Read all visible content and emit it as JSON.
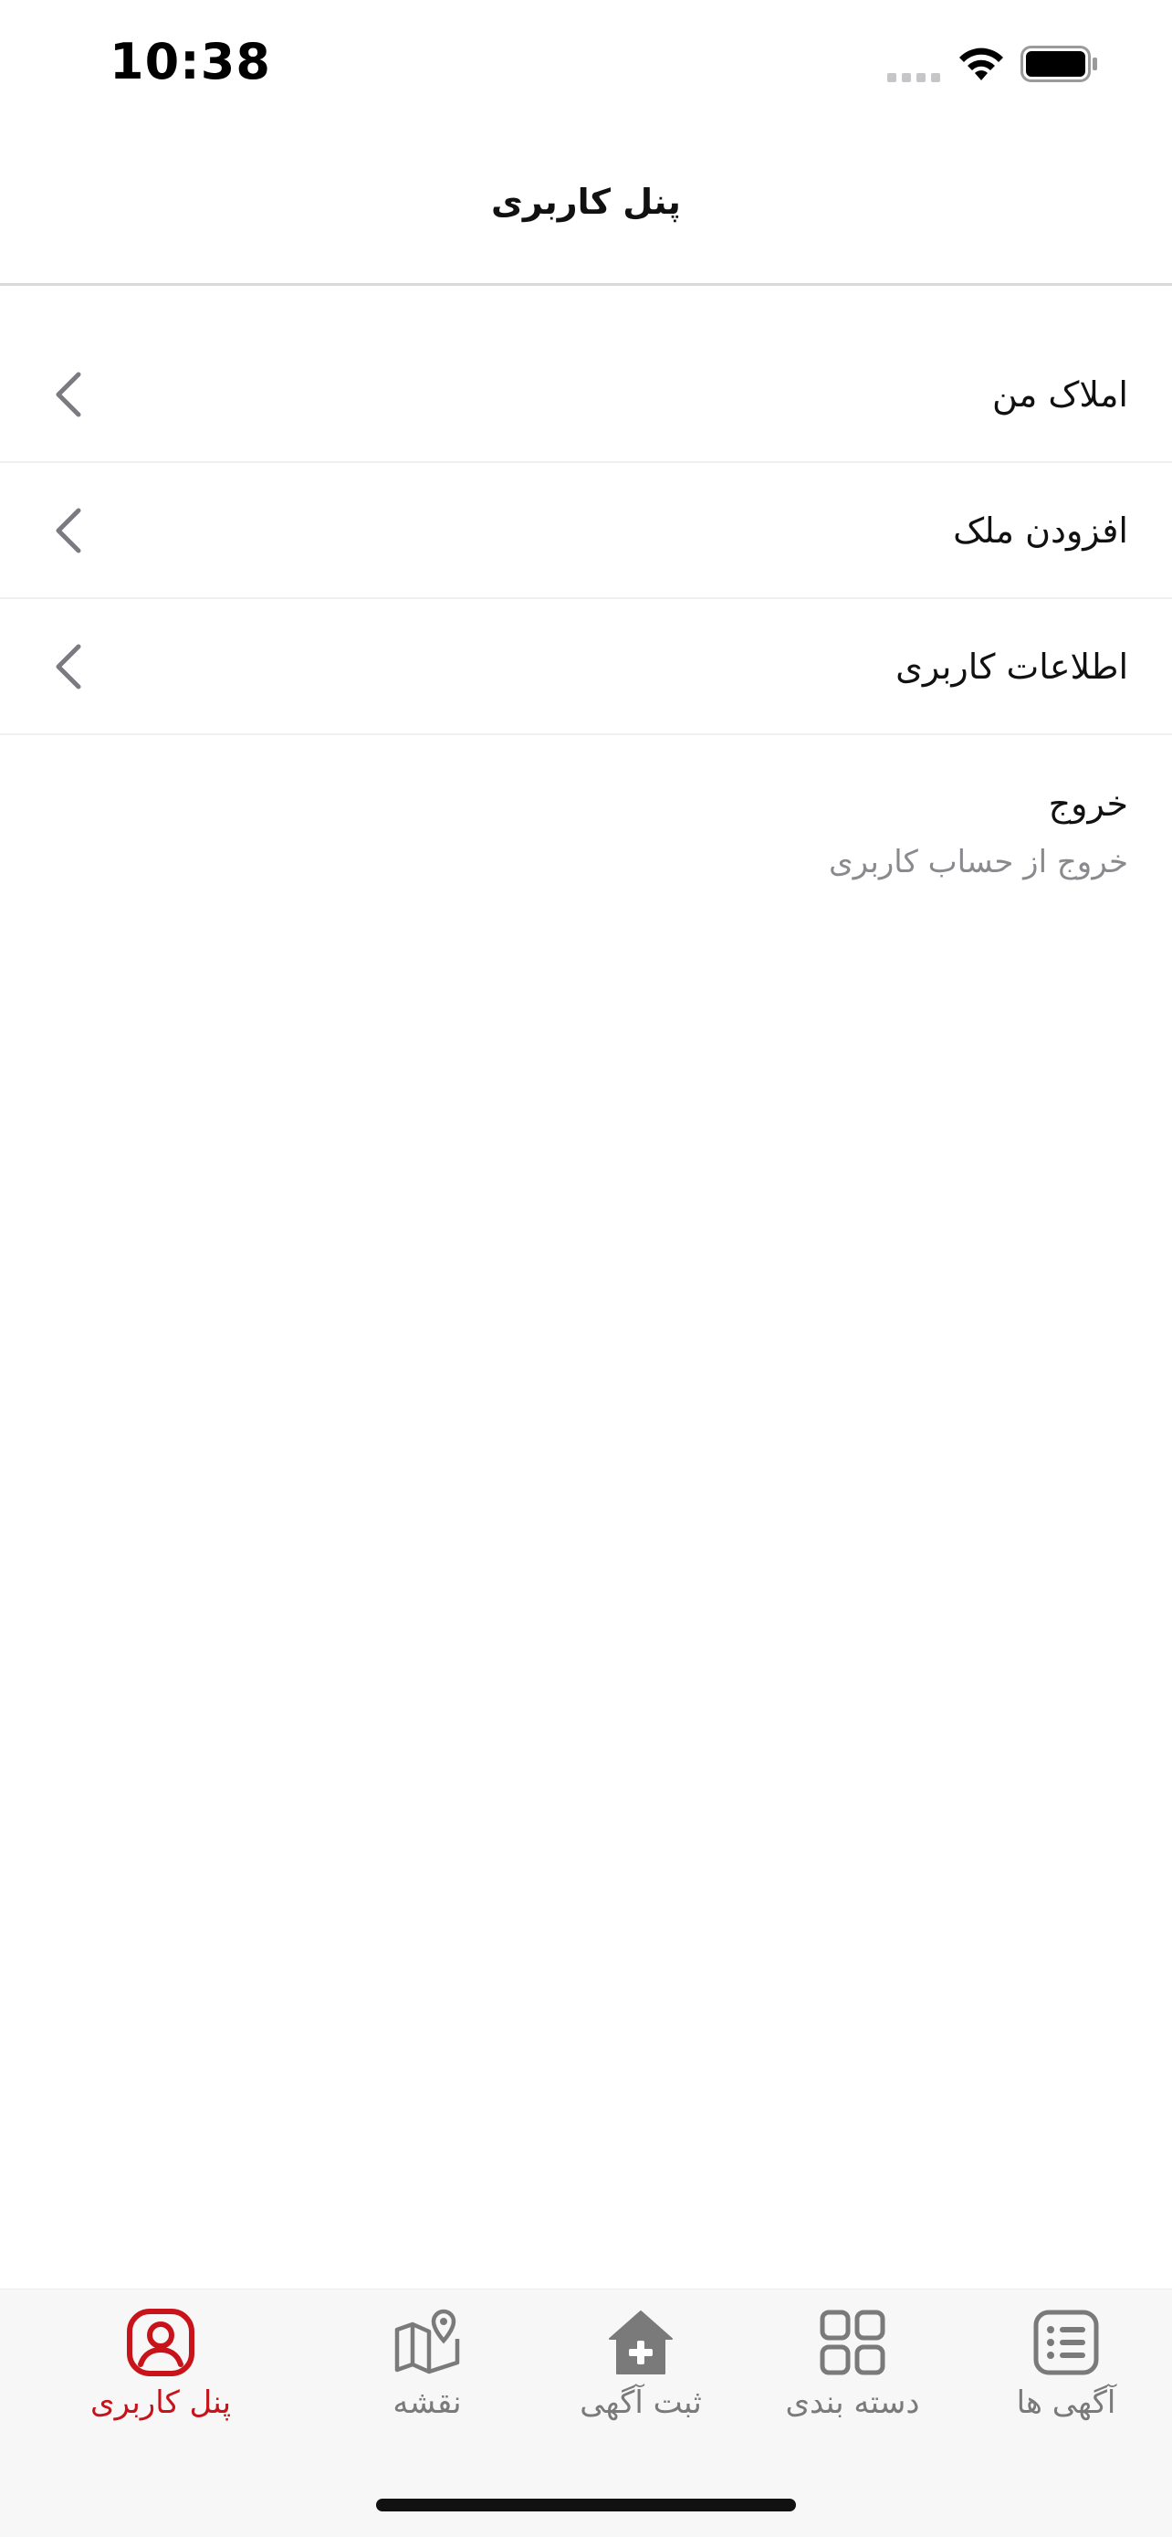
{
  "status_bar": {
    "time": "10:38",
    "icons": [
      "signal-icon",
      "wifi-icon",
      "battery-icon"
    ]
  },
  "header": {
    "title": "پنل کاربری"
  },
  "menu": {
    "items": [
      {
        "label": "املاک من",
        "icon": "chevron-left-icon"
      },
      {
        "label": "افزودن ملک",
        "icon": "chevron-left-icon"
      },
      {
        "label": "اطلاعات کاربری",
        "icon": "chevron-left-icon"
      }
    ]
  },
  "logout": {
    "title": "خروج",
    "subtitle": "خروج از حساب کاربری"
  },
  "tab_bar": {
    "active_color": "#c8131a",
    "inactive_color": "#7a7a7a",
    "tabs": [
      {
        "label": "آگهی ها",
        "icon": "list-icon",
        "active": false
      },
      {
        "label": "دسته بندی",
        "icon": "grid-icon",
        "active": false
      },
      {
        "label": "ثبت آگهی",
        "icon": "add-home-icon",
        "active": false
      },
      {
        "label": "نقشه",
        "icon": "map-icon",
        "active": false
      },
      {
        "label": "پنل کاربری",
        "icon": "user-icon",
        "active": true
      }
    ]
  }
}
